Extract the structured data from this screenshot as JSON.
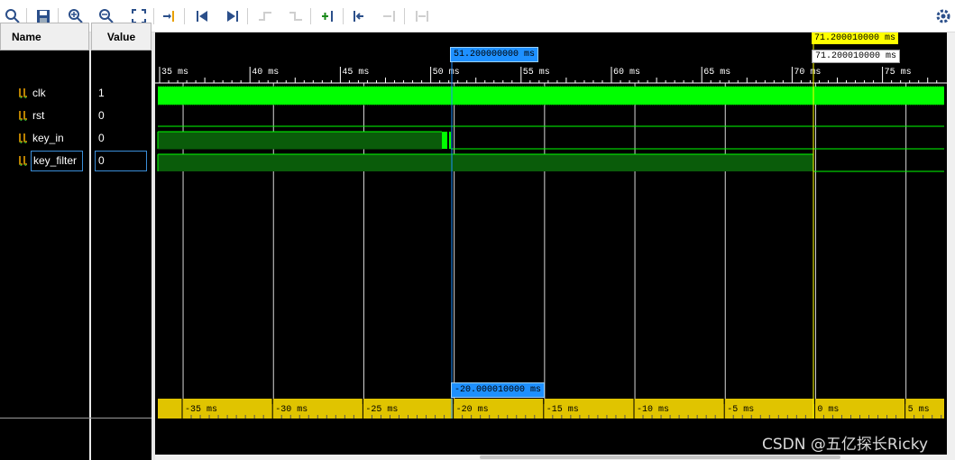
{
  "toolbar": {
    "icons": [
      "search-icon",
      "save-icon",
      "zoom-in-icon",
      "zoom-out-icon",
      "zoom-fit-icon",
      "go-to-cursor-icon",
      "go-to-time-zero-icon",
      "go-to-last-time-icon",
      "previous-transition-icon",
      "next-transition-icon",
      "add-marker-icon",
      "previous-marker-icon",
      "next-marker-icon",
      "swap-cursors-icon",
      "settings-icon"
    ]
  },
  "columns": {
    "name": "Name",
    "value": "Value"
  },
  "signals": [
    {
      "name": "clk",
      "value": "1"
    },
    {
      "name": "rst",
      "value": "0"
    },
    {
      "name": "key_in",
      "value": "0"
    },
    {
      "name": "key_filter",
      "value": "0"
    }
  ],
  "timeline": {
    "ticks": [
      "35 ms",
      "40 ms",
      "45 ms",
      "50 ms",
      "55 ms",
      "60 ms",
      "65 ms",
      "70 ms",
      "75 ms"
    ],
    "delta_ticks": [
      "-35 ms",
      "-30 ms",
      "-25 ms",
      "-20 ms",
      "-15 ms",
      "-10 ms",
      "-5 ms",
      "0 ms",
      "5 ms"
    ]
  },
  "cursors": {
    "main": "51.200000000 ms",
    "marker": "71.200010000 ms",
    "marker_readout": "71.200010000 ms",
    "delta": "-20.000010000 ms"
  },
  "colors": {
    "wave_bright": "#00ff00",
    "wave_dark": "#0a5c0a",
    "cursor": "#1e90ff",
    "marker": "#ffff00",
    "ruler": "#e0c400"
  },
  "watermark": "CSDN @五亿探长Ricky"
}
